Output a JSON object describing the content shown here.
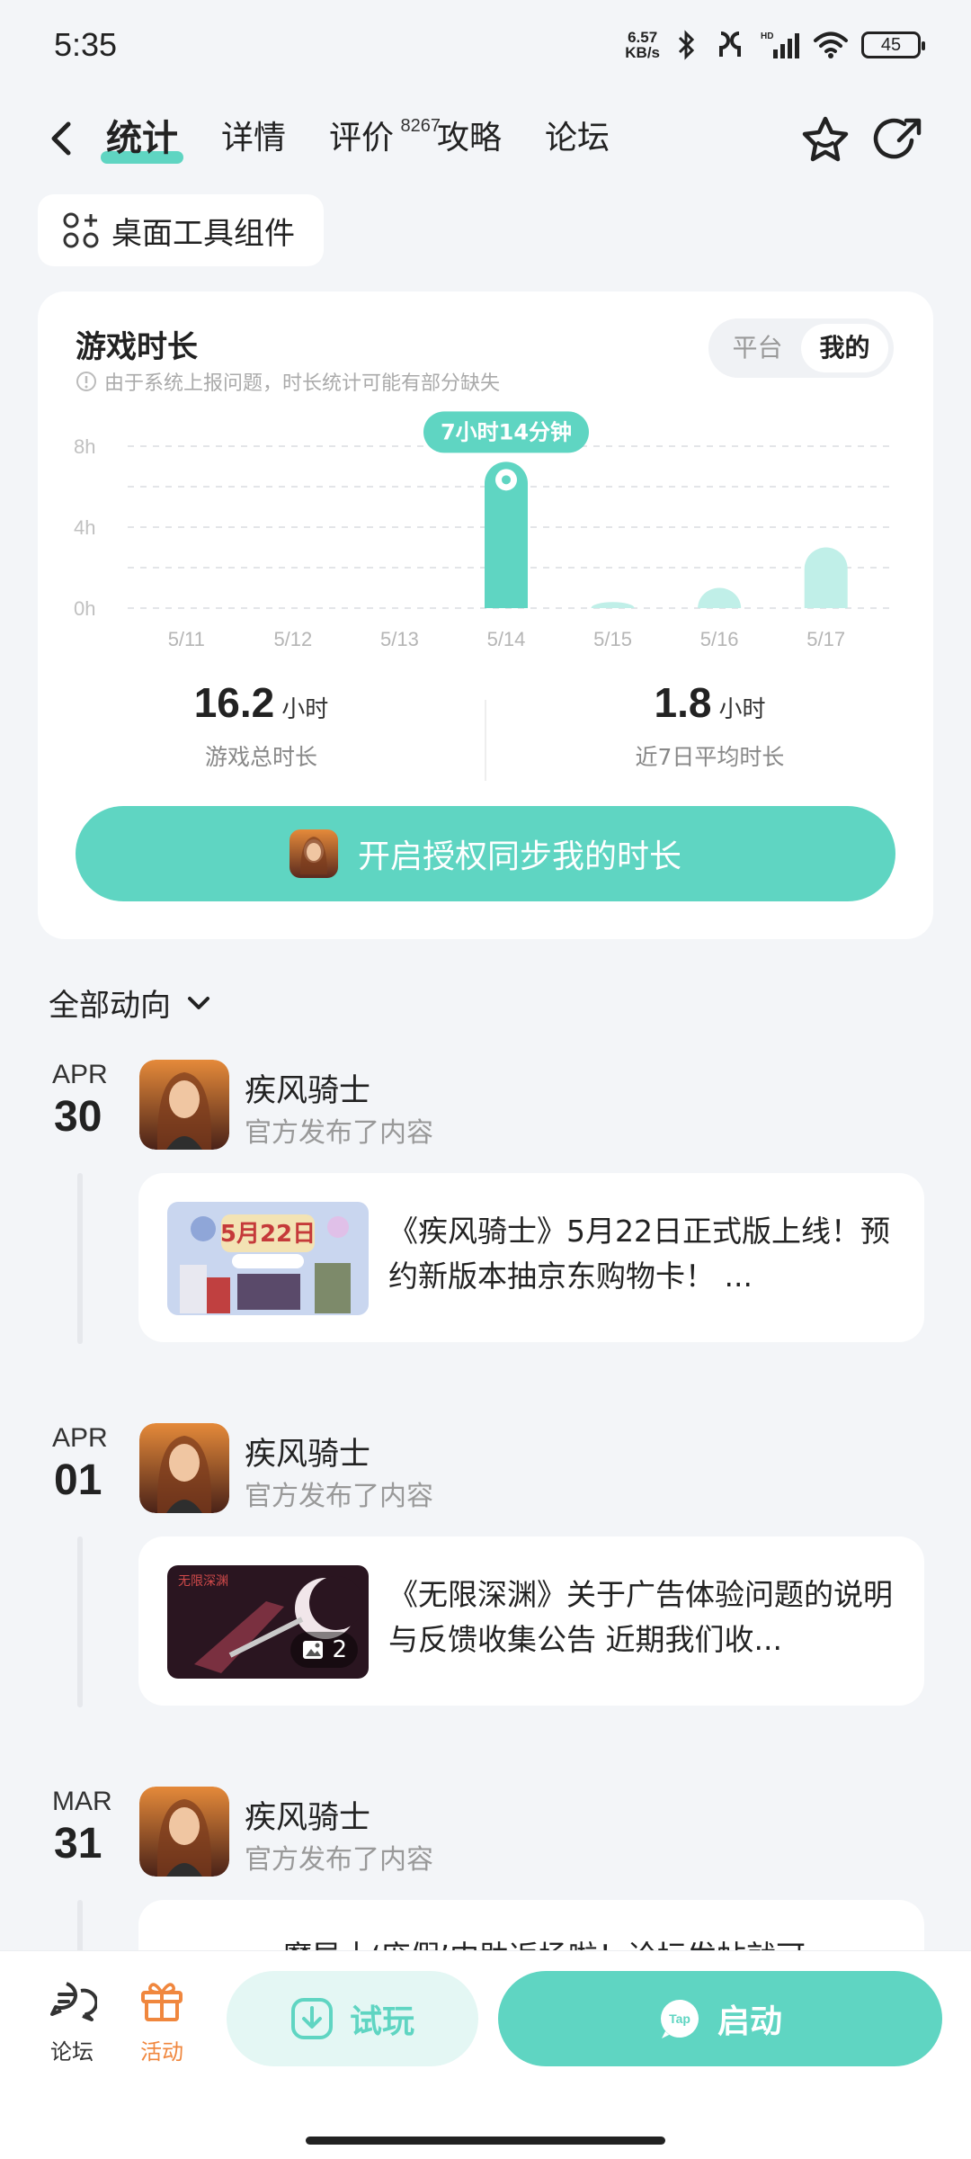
{
  "status_bar": {
    "time": "5:35",
    "net_speed_value": "6.57",
    "net_speed_unit": "KB/s",
    "battery": "45"
  },
  "nav": {
    "tabs": [
      {
        "label": "统计",
        "active": true
      },
      {
        "label": "详情"
      },
      {
        "label": "评价",
        "badge": "8267"
      },
      {
        "label": "攻略"
      },
      {
        "label": "论坛"
      }
    ],
    "icons": [
      "back-icon",
      "star-icon",
      "share-icon"
    ]
  },
  "widget_chip": {
    "label": "桌面工具组件",
    "icon": "grid-plus-icon"
  },
  "stats": {
    "title": "游戏时长",
    "note": "由于系统上报问题，时长统计可能有部分缺失",
    "segment": {
      "options": [
        "平台",
        "我的"
      ],
      "selected": "我的"
    },
    "total": {
      "value": "16.2",
      "unit": "小时",
      "label": "游戏总时长"
    },
    "average": {
      "value": "1.8",
      "unit": "小时",
      "label": "近7日平均时长"
    },
    "sync_button": "开启授权同步我的时长"
  },
  "chart_data": {
    "type": "bar",
    "categories": [
      "5/11",
      "5/12",
      "5/13",
      "5/14",
      "5/15",
      "5/16",
      "5/17"
    ],
    "values": [
      0,
      0,
      0,
      7.23,
      0.3,
      1.0,
      3.0
    ],
    "ylim": [
      0,
      8
    ],
    "yticks": [
      "0h",
      "4h",
      "8h"
    ],
    "highlight_index": 3,
    "highlight_label": "7小时14分钟",
    "grid": true,
    "colors": {
      "highlight": "#5fd5c2",
      "normal": "#c0efe8"
    }
  },
  "feed": {
    "filter_label": "全部动向",
    "items": [
      {
        "month": "APR",
        "day": "30",
        "game": "疾风骑士",
        "action": "官方发布了内容",
        "post": "《疾风骑士》5月22日正式版上线！预约新版本抽京东购物卡！ ..."
      },
      {
        "month": "APR",
        "day": "01",
        "game": "疾风骑士",
        "action": "官方发布了内容",
        "post": "《无限深渊》关于广告体验问题的说明与反馈收集公告 近期我们收...",
        "image_count": "2"
      },
      {
        "month": "MAR",
        "day": "31",
        "game": "疾风骑士",
        "action": "官方发布了内容",
        "post": "魔导士‘庞假’内助返场啦！论坛发帖就可..."
      }
    ]
  },
  "bottom_bar": {
    "forum_label": "论坛",
    "activity_label": "活动",
    "trial_label": "试玩",
    "launch_label": "启动",
    "launch_logo_text": "Tap"
  },
  "colors": {
    "accent": "#5fd5c2",
    "accent_light": "#e4f7f4",
    "activity": "#f0873e"
  }
}
